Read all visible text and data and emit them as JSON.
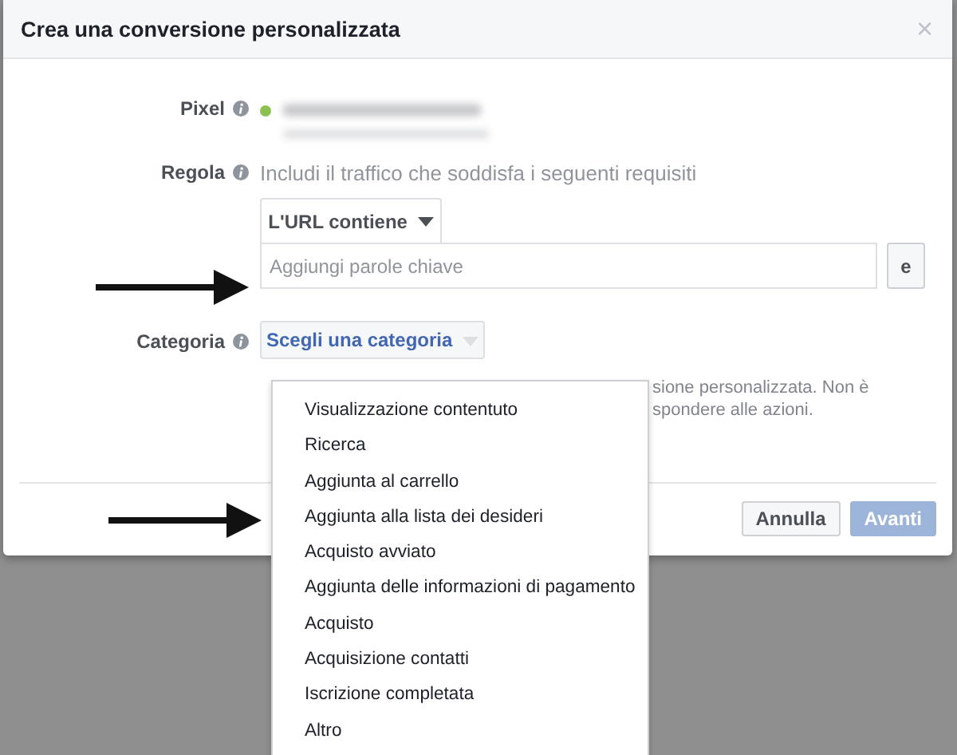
{
  "dialog": {
    "title": "Crea una conversione personalizzata",
    "close": "×"
  },
  "fields": [
    {
      "kind": "pixel",
      "label": "Pixel",
      "color": "#8cc152"
    },
    {
      "kind": "rule",
      "label": "Regola",
      "text": "Includi il traffico che soddisfa i seguenti requisiti",
      "condition": "L'URL contiene",
      "placeholder": "Aggiungi parole chiave",
      "and_button": "e"
    },
    {
      "kind": "category",
      "label": "Categoria",
      "button": "Scegli una categoria",
      "help_lines": [
        "sione personalizzata. Non è",
        "spondere alle azioni."
      ]
    }
  ],
  "dropdown": {
    "open": true,
    "items": [
      "Visualizzazione contentuto",
      "Ricerca",
      "Aggiunta al carrello",
      "Aggiunta alla lista dei desideri",
      "Acquisto avviato",
      "Aggiunta delle informazioni di pagamento",
      "Acquisto",
      "Acquisizione contatti",
      "Iscrizione completata",
      "Altro"
    ]
  },
  "footer": {
    "buttons": [
      {
        "label": "Annulla",
        "kind": "secondary",
        "disabled": false
      },
      {
        "label": "Avanti",
        "kind": "primary",
        "disabled": true
      }
    ]
  },
  "annotations": [
    {
      "kind": "arrow"
    },
    {
      "kind": "arrow"
    }
  ]
}
